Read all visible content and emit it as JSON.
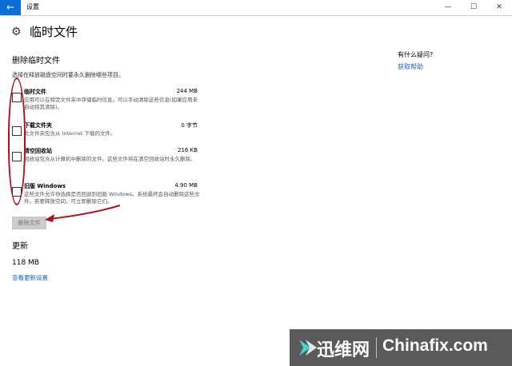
{
  "window": {
    "title": "设置",
    "back_icon": "←",
    "minimize_icon": "—",
    "maximize_icon": "☐",
    "close_icon": "✕"
  },
  "header": {
    "title": "临时文件",
    "gear_icon": "⚙"
  },
  "delete_section": {
    "heading": "删除临时文件",
    "instruction": "选择在释放磁盘空间时要永久删除哪些项目。",
    "items": [
      {
        "name": "临时文件",
        "size": "244 MB",
        "description": "应用可以在特定文件夹中存储临时信息。可以手动清除这些信息(如果应用未自动将其清除)。"
      },
      {
        "name": "下载文件夹",
        "size": "0 字节",
        "description": "此文件夹包含从 Internet 下载的文件。"
      },
      {
        "name": "清空回收站",
        "size": "216 KB",
        "description": "回收站包含从计算机中删除的文件。这些文件将在清空回收站时永久删除。"
      },
      {
        "name": "旧版 Windows",
        "size": "4.90 MB",
        "description": "这些文件允许你选择是否回退到旧版 Windows。系统最终会自动删除这些文件。若要释放空间，可立即删除它们。"
      }
    ],
    "delete_button": "删除文件"
  },
  "sidebar": {
    "question": "有什么疑问?",
    "help_link": "获取帮助"
  },
  "update_section": {
    "heading": "更新",
    "size": "118 MB",
    "link": "查看更新设置"
  },
  "watermark": {
    "cn": "迅维网",
    "en": "Chinafix.com"
  },
  "colors": {
    "accent": "#0a6fd8",
    "link": "#1a64c8",
    "annotation": "#b0101a",
    "watermark_bg": "#5a5a5a"
  }
}
